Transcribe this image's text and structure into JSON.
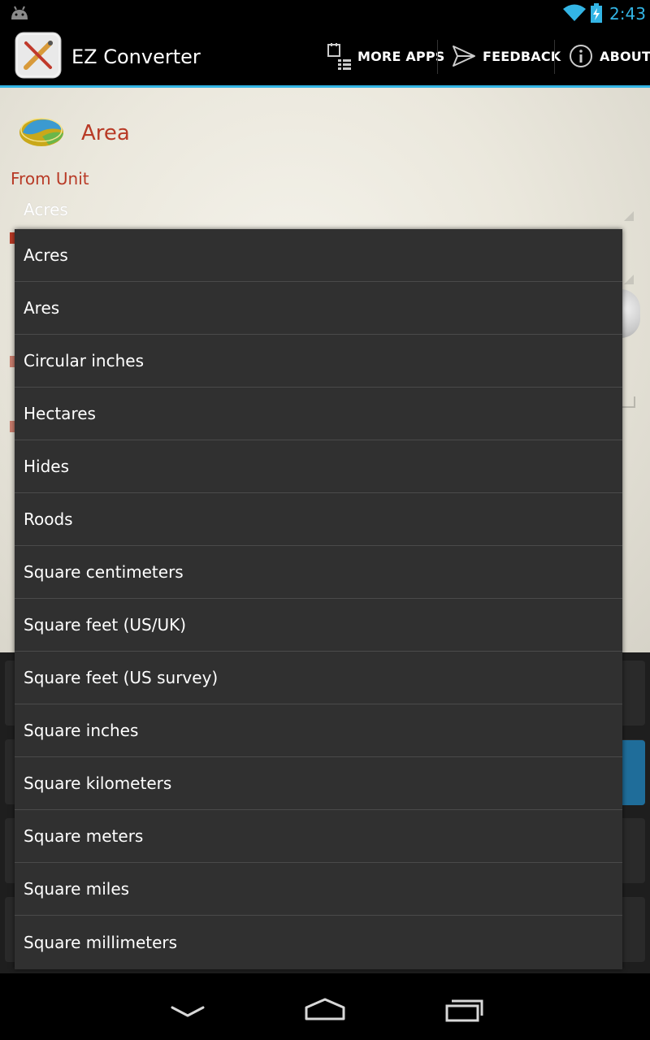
{
  "status_bar": {
    "time": "2:43"
  },
  "action_bar": {
    "title": "EZ Converter",
    "more_apps": "MORE APPS",
    "feedback": "FEEDBACK",
    "about": "ABOUT"
  },
  "content": {
    "category_title": "Area",
    "from_label": "From Unit",
    "from_value": "Acres"
  },
  "dropdown": {
    "items": [
      "Acres",
      "Ares",
      "Circular inches",
      "Hectares",
      "Hides",
      "Roods",
      "Square centimeters",
      "Square feet (US/UK)",
      "Square feet (US survey)",
      "Square inches",
      "Square kilometers",
      "Square meters",
      "Square miles",
      "Square millimeters"
    ]
  },
  "colors": {
    "accent": "#33b5e5",
    "label_red": "#b83a26",
    "dropdown_bg": "#303030"
  }
}
